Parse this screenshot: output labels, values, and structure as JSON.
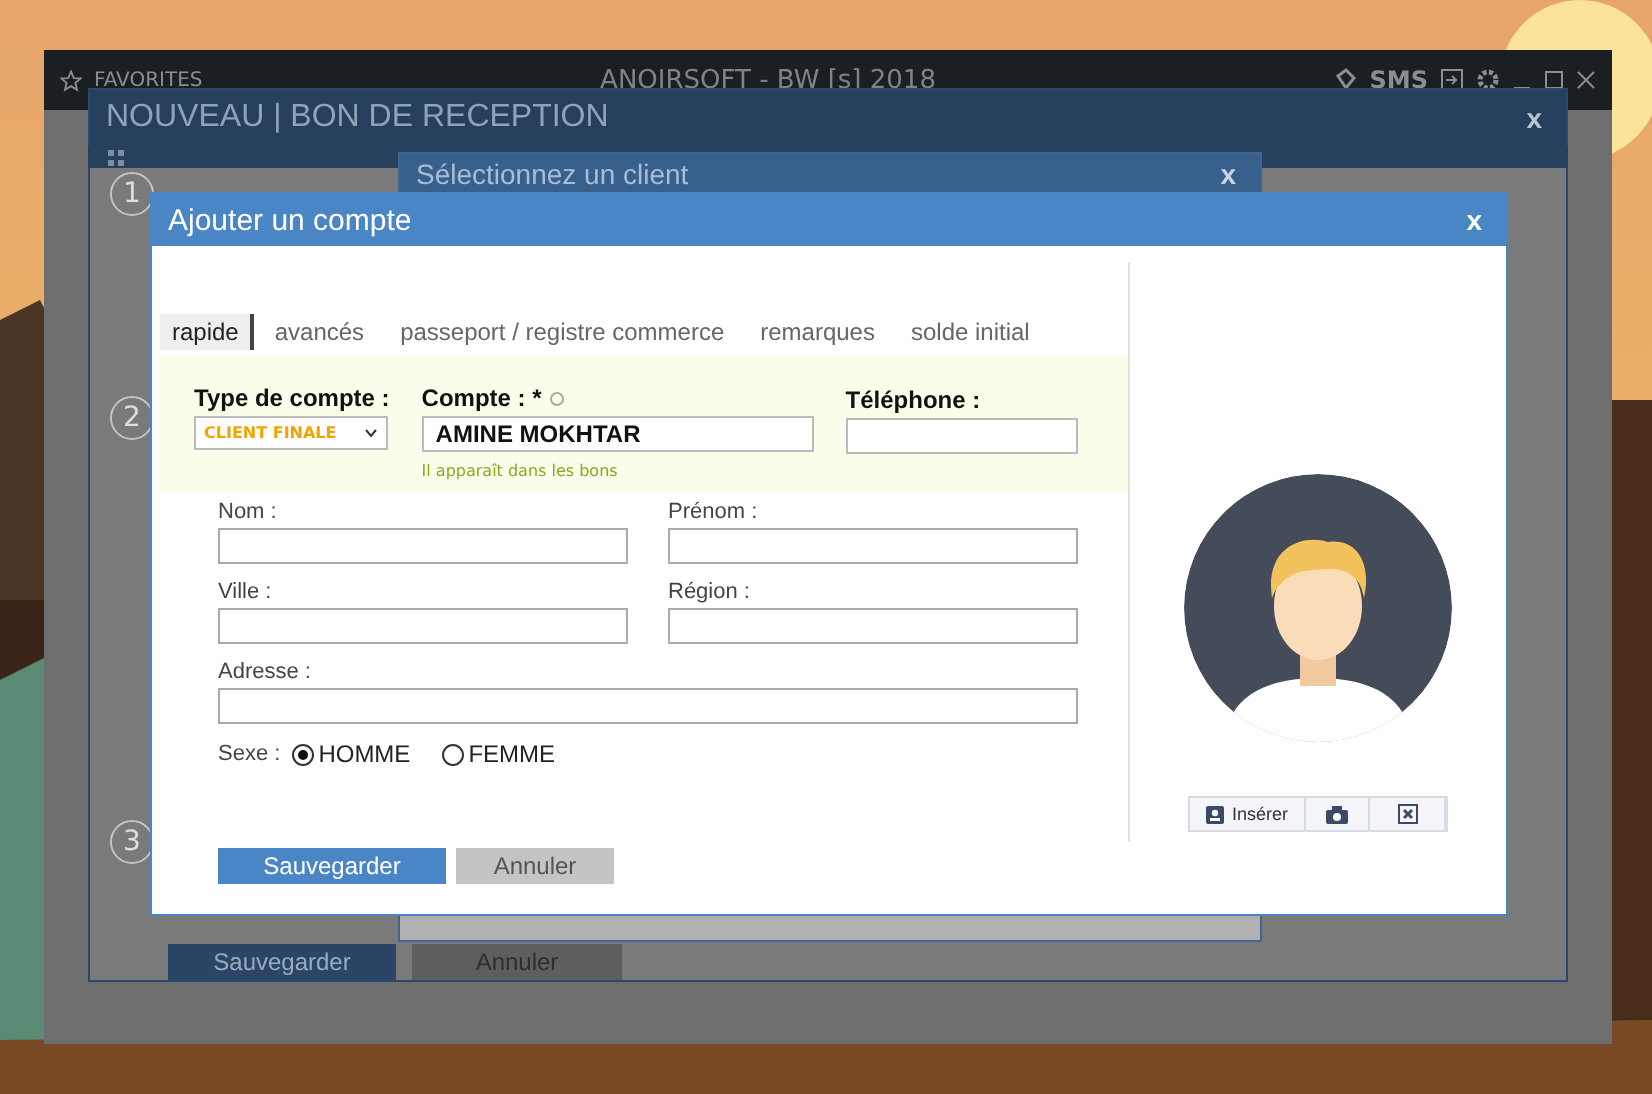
{
  "app": {
    "favorites": "FAVORITES",
    "title": "ANOIRSOFT - BW [s] 2018",
    "sms": "SMS"
  },
  "reception_dialog": {
    "title": "NOUVEAU | BON DE RECEPTION",
    "close": "x",
    "steps": [
      "1",
      "2",
      "3"
    ],
    "buttons": [
      "Sauvegarder",
      "Annuler"
    ]
  },
  "client_dialog": {
    "title": "Sélectionnez un client",
    "close": "x"
  },
  "account_dialog": {
    "title": "Ajouter un compte",
    "close": "x",
    "tabs": [
      {
        "label": "rapide",
        "selected": true
      },
      {
        "label": "avancés",
        "selected": false
      },
      {
        "label": "passeport / registre commerce",
        "selected": false
      },
      {
        "label": "remarques",
        "selected": false
      },
      {
        "label": "solde initial",
        "selected": false
      }
    ],
    "type_label": "Type de compte :",
    "type_value": "CLIENT FINALE",
    "account_label": "Compte : *",
    "account_value": "AMINE MOKHTAR",
    "account_hint": "Il apparaît dans les bons",
    "phone_label": "Téléphone :",
    "fields": [
      {
        "label": "Nom :",
        "wide": false
      },
      {
        "label": "Prénom :",
        "wide": false
      },
      {
        "label": "Ville :",
        "wide": false
      },
      {
        "label": "Région :",
        "wide": false
      },
      {
        "label": "Adresse :",
        "wide": true
      }
    ],
    "sexe_label": "Sexe :",
    "options": [
      {
        "label": "HOMME",
        "selected": true
      },
      {
        "label": "FEMME",
        "selected": false
      }
    ],
    "buttons": [
      "Sauvegarder",
      "Annuler"
    ],
    "insert": "Insérer"
  }
}
